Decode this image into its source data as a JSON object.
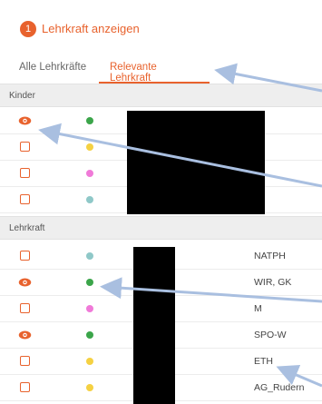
{
  "header": {
    "step": "1",
    "title": "Lehrkraft anzeigen"
  },
  "tabs": [
    {
      "label": "Alle Lehrkräfte",
      "active": false
    },
    {
      "label": "Relevante Lehrkraft",
      "active": true
    }
  ],
  "sections": {
    "kinder": {
      "label": "Kinder"
    },
    "lehrkraft": {
      "label": "Lehrkraft"
    }
  },
  "kinder_rows": [
    {
      "selector": "eye-icon",
      "color": "#3ba54a"
    },
    {
      "selector": "checkbox",
      "color": "#f5d142"
    },
    {
      "selector": "checkbox",
      "color": "#f07ad8"
    },
    {
      "selector": "checkbox",
      "color": "#8fc8c8"
    }
  ],
  "lehrkraft_rows": [
    {
      "selector": "checkbox",
      "color": "#8fc8c8",
      "code": "NATPH"
    },
    {
      "selector": "eye-icon",
      "color": "#3ba54a",
      "code": "WIR, GK"
    },
    {
      "selector": "checkbox",
      "color": "#f07ad8",
      "code": "M"
    },
    {
      "selector": "eye-icon",
      "color": "#3ba54a",
      "code": "SPO-W"
    },
    {
      "selector": "checkbox",
      "color": "#f5d142",
      "code": "ETH"
    },
    {
      "selector": "checkbox",
      "color": "#f5d142",
      "code": "AG_Rudern"
    }
  ],
  "colors": {
    "accent": "#e8622d",
    "annotation_arrow": "#a9bfe0"
  }
}
